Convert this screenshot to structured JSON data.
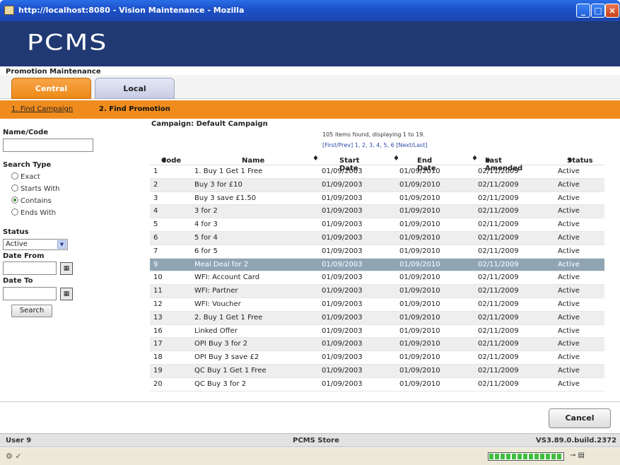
{
  "window": {
    "title": "http://localhost:8080 - Vision Maintenance - Mozilla"
  },
  "banner": {
    "logo_text": "PCMS"
  },
  "page": {
    "heading": "Promotion Maintenance"
  },
  "tabs": [
    {
      "label": "Central",
      "active": true
    },
    {
      "label": "Local",
      "active": false
    }
  ],
  "steps": {
    "step1": "1. Find Campaign",
    "step2": "2. Find Promotion"
  },
  "search": {
    "name_code_label": "Name/Code",
    "name_code_value": "",
    "search_type_label": "Search Type",
    "search_types": [
      {
        "label": "Exact",
        "selected": false
      },
      {
        "label": "Starts With",
        "selected": false
      },
      {
        "label": "Contains",
        "selected": true
      },
      {
        "label": "Ends With",
        "selected": false
      }
    ],
    "status_label": "Status",
    "status_value": "Active",
    "date_from_label": "Date From",
    "date_to_label": "Date To",
    "search_button": "Search"
  },
  "results": {
    "campaign_label": "Campaign: Default Campaign",
    "found_text": "105 items found, displaying 1 to 19.",
    "pager_text": "[First/Prev] 1, 2, 3, 4, 5, 6 [Next/Last]",
    "columns": [
      "Code",
      "Name",
      "Start Date",
      "End Date",
      "Last Amended",
      "Status"
    ],
    "sort_glyph": "♦",
    "rows": [
      [
        "1",
        "1. Buy 1 Get 1 Free",
        "01/09/2003",
        "01/09/2010",
        "02/11/2009",
        "Active"
      ],
      [
        "2",
        "Buy 3 for £10",
        "01/09/2003",
        "01/09/2010",
        "02/11/2009",
        "Active"
      ],
      [
        "3",
        "Buy 3 save £1.50",
        "01/09/2003",
        "01/09/2010",
        "02/11/2009",
        "Active"
      ],
      [
        "4",
        "3 for 2",
        "01/09/2003",
        "01/09/2010",
        "02/11/2009",
        "Active"
      ],
      [
        "5",
        "4 for 3",
        "01/09/2003",
        "01/09/2010",
        "02/11/2009",
        "Active"
      ],
      [
        "6",
        "5 for 4",
        "01/09/2003",
        "01/09/2010",
        "02/11/2009",
        "Active"
      ],
      [
        "7",
        "6 for 5",
        "01/09/2003",
        "01/09/2010",
        "02/11/2009",
        "Active"
      ],
      [
        "9",
        "Meal Deal for 2",
        "01/09/2003",
        "01/09/2010",
        "02/11/2009",
        "Active"
      ],
      [
        "10",
        "WFI: Account Card",
        "01/09/2003",
        "01/09/2010",
        "02/11/2009",
        "Active"
      ],
      [
        "11",
        "WFI: Partner",
        "01/09/2003",
        "01/09/2010",
        "02/11/2009",
        "Active"
      ],
      [
        "12",
        "WFI: Voucher",
        "01/09/2003",
        "01/09/2010",
        "02/11/2009",
        "Active"
      ],
      [
        "13",
        "2. Buy 1 Get 1 Free",
        "01/09/2003",
        "01/09/2010",
        "02/11/2009",
        "Active"
      ],
      [
        "16",
        "Linked Offer",
        "01/09/2003",
        "01/09/2010",
        "02/11/2009",
        "Active"
      ],
      [
        "17",
        "OPI Buy 3 for 2",
        "01/09/2003",
        "01/09/2010",
        "02/11/2009",
        "Active"
      ],
      [
        "18",
        "OPI Buy 3 save £2",
        "01/09/2003",
        "01/09/2010",
        "02/11/2009",
        "Active"
      ],
      [
        "19",
        "QC Buy 1 Get 1 Free",
        "01/09/2003",
        "01/09/2010",
        "02/11/2009",
        "Active"
      ],
      [
        "20",
        "QC Buy 3 for 2",
        "01/09/2003",
        "01/09/2010",
        "02/11/2009",
        "Active"
      ]
    ],
    "selected_code": "9"
  },
  "footer": {
    "cancel_button": "Cancel",
    "user": "User 9",
    "store": "PCMS Store",
    "version": "VS3.89.0.build.2372"
  },
  "colors": {
    "accent": "#f08c1d",
    "banner": "#203973",
    "selected_row": "#8fa5b4"
  }
}
